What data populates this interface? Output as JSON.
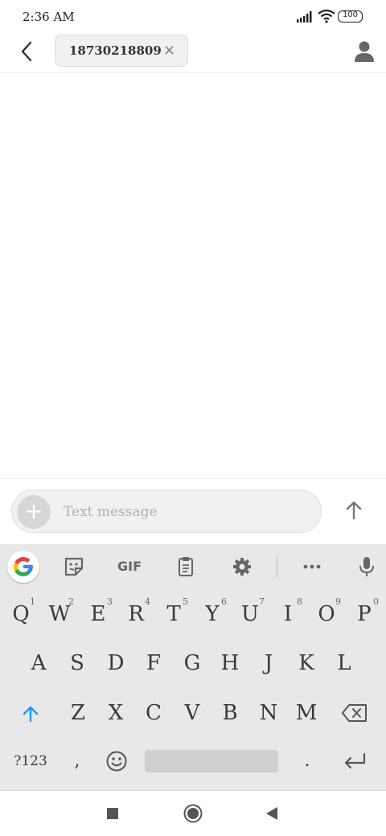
{
  "status_bar": {
    "time": "2:36 AM",
    "battery": "100"
  },
  "header": {
    "recipient": "18730218809",
    "remove_glyph": "×"
  },
  "composer": {
    "placeholder": "Text message",
    "add_glyph": "+"
  },
  "keyboard": {
    "toolbar": {
      "gif_label": "GIF"
    },
    "row1": [
      {
        "key": "Q",
        "hint": "1"
      },
      {
        "key": "W",
        "hint": "2"
      },
      {
        "key": "E",
        "hint": "3"
      },
      {
        "key": "R",
        "hint": "4"
      },
      {
        "key": "T",
        "hint": "5"
      },
      {
        "key": "Y",
        "hint": "6"
      },
      {
        "key": "U",
        "hint": "7"
      },
      {
        "key": "I",
        "hint": "8"
      },
      {
        "key": "O",
        "hint": "9"
      },
      {
        "key": "P",
        "hint": "0"
      }
    ],
    "row2": [
      "A",
      "S",
      "D",
      "F",
      "G",
      "H",
      "J",
      "K",
      "L"
    ],
    "row3": [
      "Z",
      "X",
      "C",
      "V",
      "B",
      "N",
      "M"
    ],
    "row4": {
      "symbols": "?123",
      "comma": ",",
      "period": "."
    }
  },
  "icons": {
    "back": "chevron-left-icon",
    "contact": "person-icon",
    "send": "arrow-up-icon",
    "google": "google-g-icon",
    "sticker": "sticker-icon",
    "clipboard": "clipboard-icon",
    "settings": "gear-icon",
    "more": "more-horizontal-icon",
    "mic": "microphone-icon",
    "shift": "shift-arrow-icon",
    "backspace": "backspace-icon",
    "emoji": "emoji-icon",
    "enter": "enter-return-icon",
    "nav_recents": "square-icon",
    "nav_home": "circle-icon",
    "nav_back": "triangle-back-icon"
  },
  "colors": {
    "accent": "#2196f3",
    "keyboard_bg": "#e8e8e8",
    "chip_bg": "#f1f1f1"
  }
}
